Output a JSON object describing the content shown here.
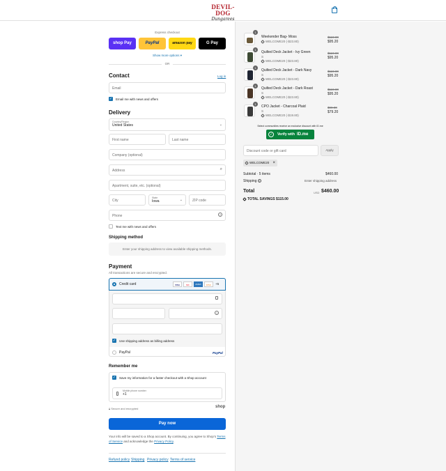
{
  "header": {
    "logo_top": "DEVIL-DOG",
    "logo_bottom": "Dungarees"
  },
  "express": {
    "label": "Express checkout",
    "shop_pay": "shop Pay",
    "paypal": "PayPal",
    "amazon_pay": "amazon pay",
    "gpay": "G Pay",
    "show_more": "Show more options",
    "or": "OR"
  },
  "contact": {
    "heading": "Contact",
    "login": "Log in",
    "email_placeholder": "Email",
    "news_label": "Email me with news and offers"
  },
  "delivery": {
    "heading": "Delivery",
    "country_label": "Country/Region",
    "country_value": "United States",
    "first_name": "First name",
    "last_name": "Last name",
    "company": "Company (optional)",
    "address": "Address",
    "apartment": "Apartment, suite, etc. (optional)",
    "city": "City",
    "state_label": "State",
    "state_value": "Iowa",
    "zip": "ZIP code",
    "phone": "Phone",
    "text_label": "Text me with news and offers"
  },
  "shipping_method": {
    "heading": "Shipping method",
    "message": "Enter your shipping address to view available shipping methods."
  },
  "payment": {
    "heading": "Payment",
    "subtitle": "All transactions are secure and encrypted.",
    "credit_card": "Credit card",
    "cards": [
      "VISA",
      "MC",
      "AMEX",
      "DISC"
    ],
    "more_cards": "+5",
    "billing_label": "Use shipping address as billing address",
    "paypal_label": "PayPal",
    "paypal_logo": "PayPal"
  },
  "remember": {
    "heading": "Remember me",
    "save_label": "Save my information for a faster checkout with a Shop account",
    "phone_label": "Mobile phone number",
    "phone_value": "+1",
    "secure_label": "Secure and encrypted",
    "shop_logo": "shop"
  },
  "pay_button": "Pay now",
  "legal": {
    "text1": "Your info will be saved to a Shop account. By continuing, you agree to Shop’s",
    "tos": "Terms of Service",
    "text2": "and acknowledge the",
    "privacy": "Privacy Policy",
    "end": "."
  },
  "footer": [
    "Refund policy",
    "Shipping",
    "Privacy policy",
    "Terms of service"
  ],
  "cart": {
    "items": [
      {
        "qty": "1",
        "name": "Weekender Bag- Moss",
        "variant": "",
        "discount": "WELCOME20 (-$23.80)",
        "old_price": "$119.00",
        "price": "$95.20"
      },
      {
        "qty": "1",
        "name": "Quilted Deck Jacket - Ivy Green",
        "variant": "S",
        "discount": "WELCOME20 (-$23.80)",
        "old_price": "$119.00",
        "price": "$95.20"
      },
      {
        "qty": "1",
        "name": "Quilted Deck Jacket - Dark Navy",
        "variant": "S",
        "discount": "WELCOME20 (-$23.80)",
        "old_price": "$119.00",
        "price": "$95.20"
      },
      {
        "qty": "1",
        "name": "Quilted Deck Jacket - Dark Roast",
        "variant": "S",
        "discount": "WELCOME20 (-$23.80)",
        "old_price": "$119.00",
        "price": "$95.20"
      },
      {
        "qty": "1",
        "name": "CPO Jacket - Charcoal Plaid",
        "variant": "S",
        "discount": "WELCOME20 (-$19.80)",
        "old_price": "$99.00",
        "price": "$79.20"
      }
    ],
    "id_note": "Select communities receive an exclusive discount with ID.me",
    "verify_label": "Verify with",
    "idme": "ID.me",
    "discount_placeholder": "Discount code or gift card",
    "apply": "Apply",
    "applied_code": "WELCOME20",
    "subtotal_label": "Subtotal · 5 items",
    "subtotal_value": "$460.00",
    "shipping_label": "Shipping",
    "shipping_value": "Enter shipping address",
    "total_label": "Total",
    "currency": "USD",
    "total_value": "$460.00",
    "savings_label": "TOTAL SAVINGS",
    "savings_value": "$115.00"
  },
  "colors": {
    "accent": "#1773b0",
    "pay_button": "#0a66d8",
    "shop_pay": "#5a31f4",
    "paypal": "#ffc439",
    "idme": "#08833d",
    "brand_red": "#b3202a"
  }
}
